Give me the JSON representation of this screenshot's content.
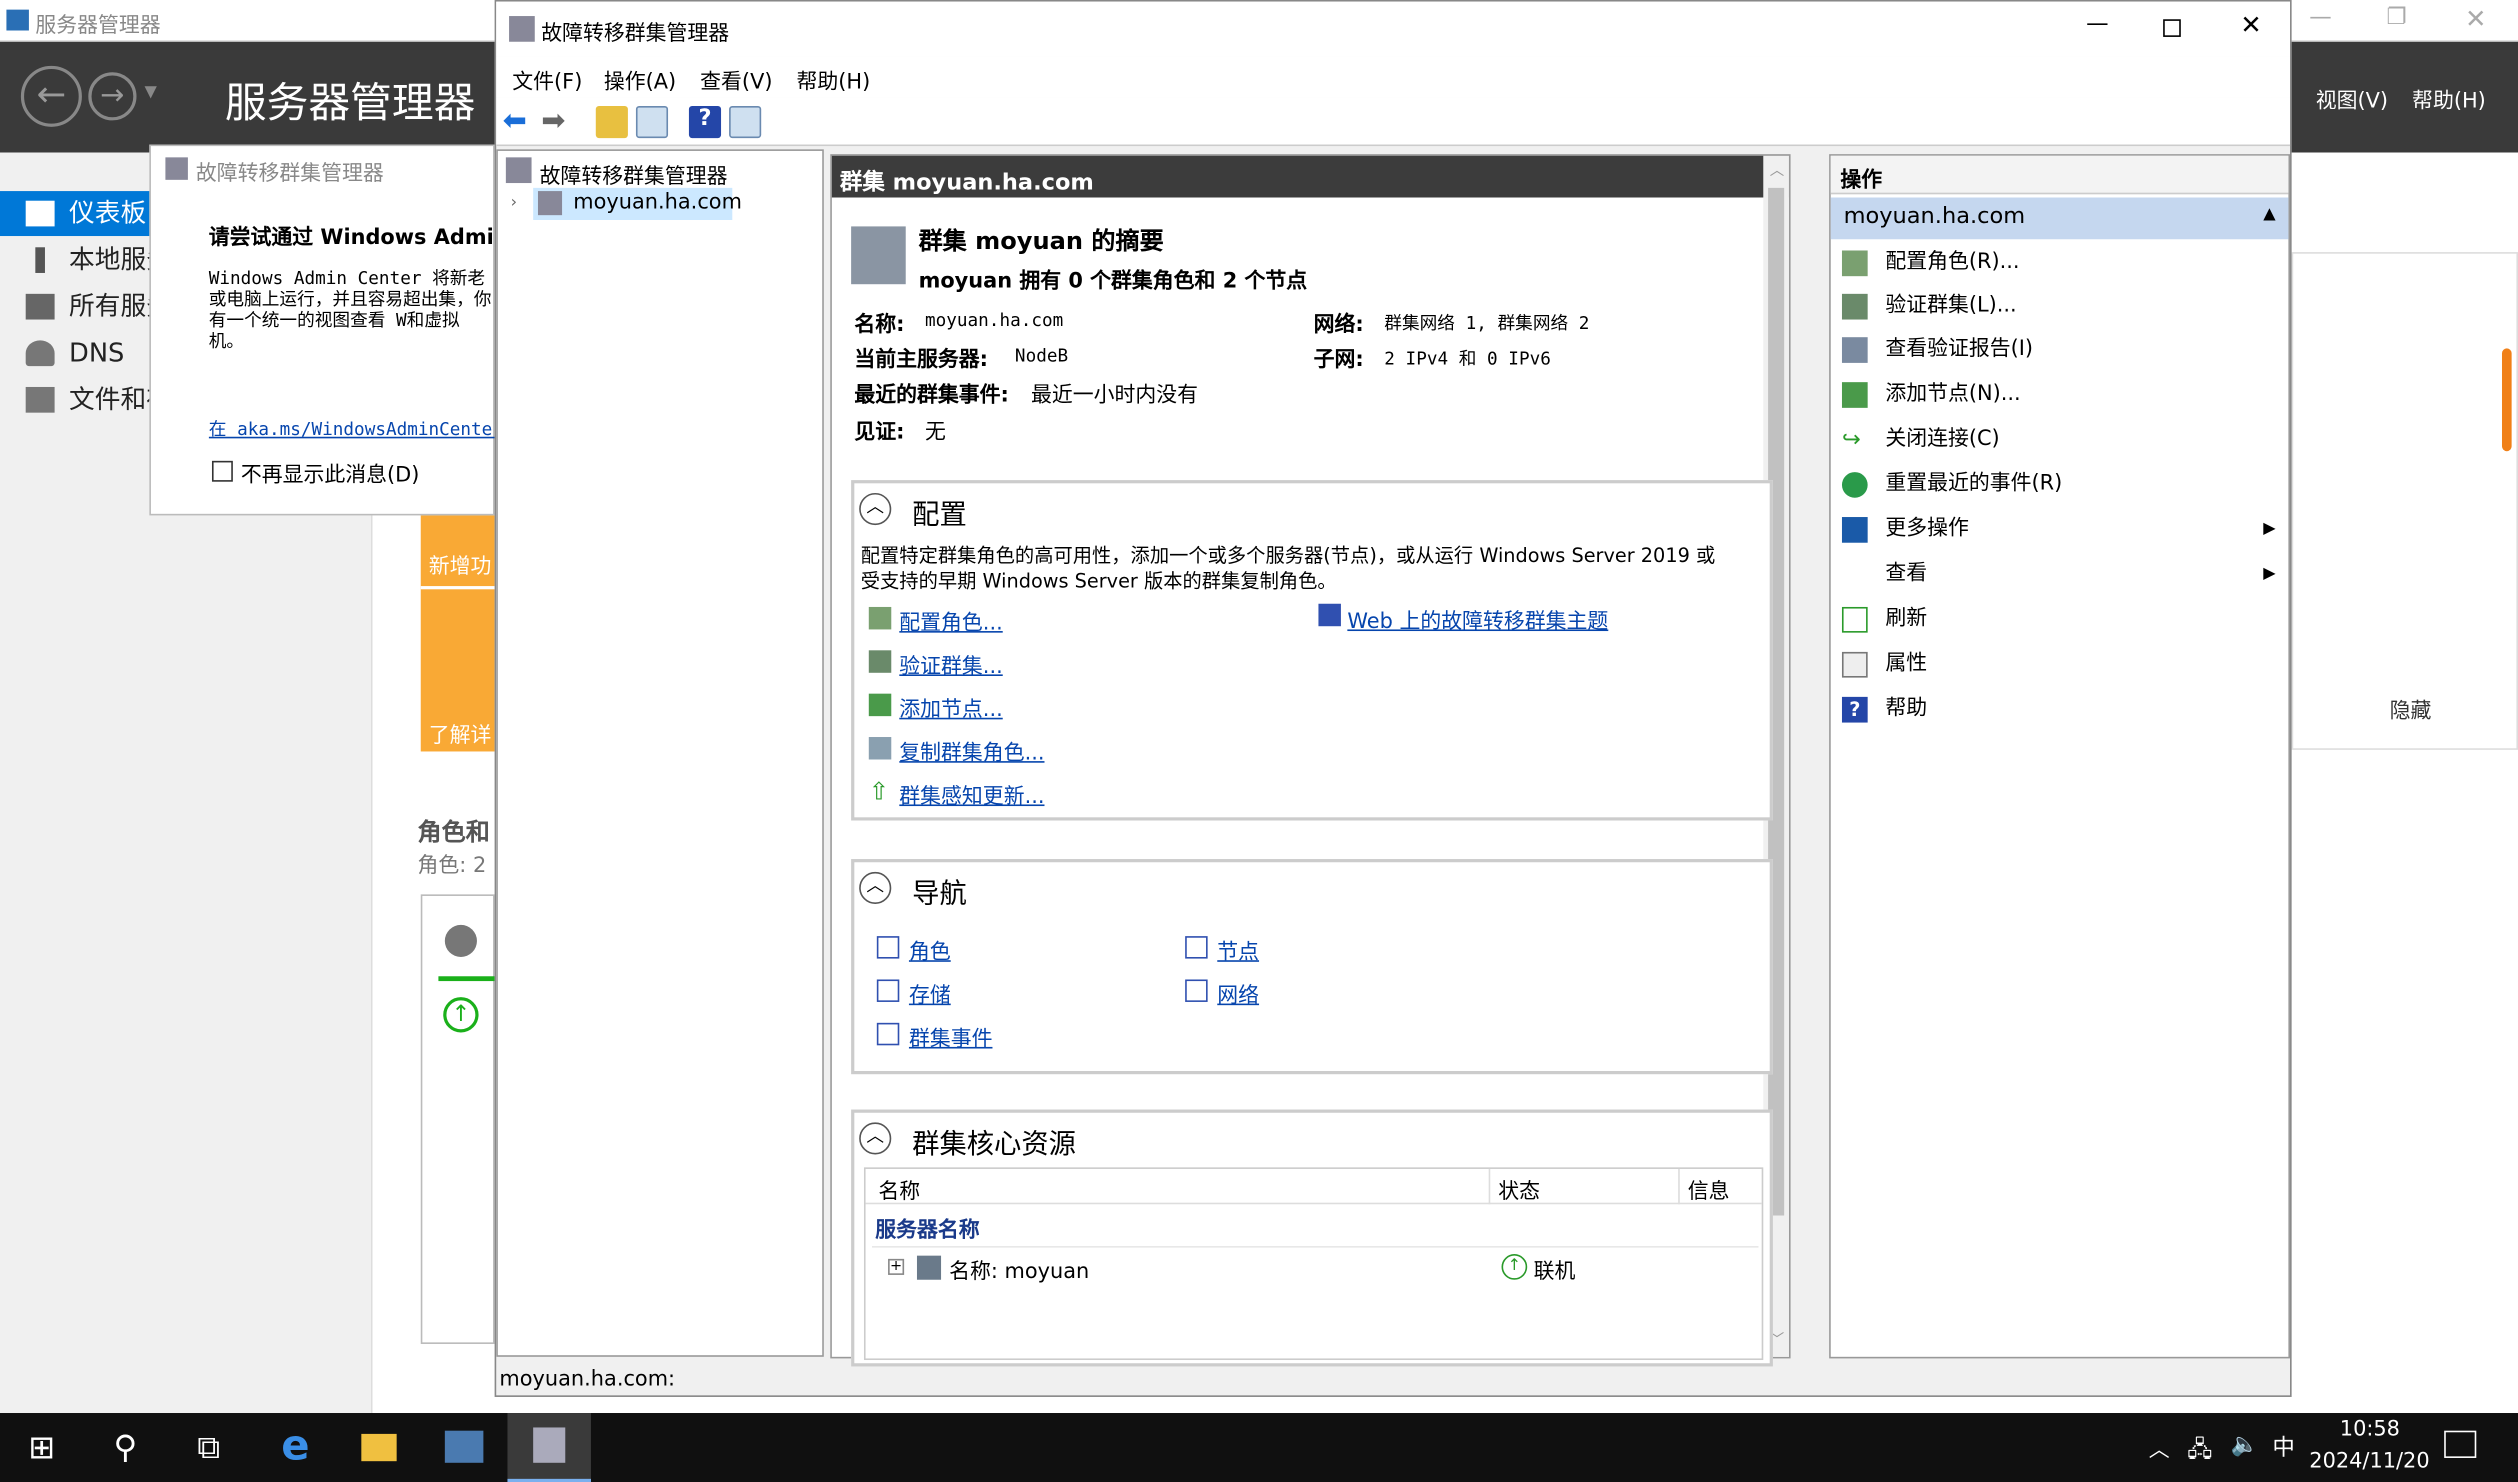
{
  "server_manager": {
    "window_title": "服务器管理器",
    "header_title": "服务器管理器",
    "menu_view": "视图(V)",
    "menu_help": "帮助(H)",
    "nav": [
      "仪表板",
      "本地服务",
      "所有服务",
      "DNS",
      "文件和存"
    ],
    "tile_new": "新增功",
    "tile_learn": "了解详",
    "roles_heading": "角色和",
    "roles_count": "角色: 2",
    "hide": "隐藏"
  },
  "wac_popup": {
    "title": "故障转移群集管理器",
    "heading": "请尝试通过 Windows Admin C",
    "body": "Windows Admin Center 将新老或电脑上运行，并且容易超出集，你有一个统一的视图查看 W和虚拟机。",
    "link": "在 aka.ms/WindowsAdminCenter",
    "checkbox": "不再显示此消息(D)"
  },
  "fcm": {
    "window_title": "故障转移群集管理器",
    "menu": [
      "文件(F)",
      "操作(A)",
      "查看(V)",
      "帮助(H)"
    ],
    "tree_root": "故障转移群集管理器",
    "tree_child": "moyuan.ha.com",
    "center_header": "群集 moyuan.ha.com",
    "summary_title": "群集 moyuan 的摘要",
    "summary_sub": "moyuan 拥有 0 个群集角色和 2 个节点",
    "name_label": "名称:",
    "name_value": "moyuan.ha.com",
    "host_label": "当前主服务器:",
    "host_value": "NodeB",
    "events_label": "最近的群集事件:",
    "events_value": "最近一小时内没有",
    "witness_label": "见证:",
    "witness_value": "无",
    "network_label": "网络:",
    "network_value": "群集网络 1, 群集网络 2",
    "subnet_label": "子网:",
    "subnet_value": "2 IPv4 和 0 IPv6",
    "config": {
      "title": "配置",
      "desc1": "配置特定群集角色的高可用性，添加一个或多个服务器(节点)，或从运行 Windows Server 2019 或",
      "desc2": "受支持的早期 Windows Server 版本的群集复制角色。",
      "links": [
        "配置角色...",
        "验证群集...",
        "添加节点...",
        "复制群集角色...",
        "群集感知更新..."
      ],
      "web_link": "Web 上的故障转移群集主题"
    },
    "nav": {
      "title": "导航",
      "links": [
        "角色",
        "节点",
        "存储",
        "网络",
        "群集事件"
      ]
    },
    "core": {
      "title": "群集核心资源",
      "columns": [
        "名称",
        "状态",
        "信息"
      ],
      "group": "服务器名称",
      "row_name": "名称: moyuan",
      "row_status": "联机"
    },
    "actions": {
      "header": "操作",
      "selected": "moyuan.ha.com",
      "items": [
        "配置角色(R)...",
        "验证群集(L)...",
        "查看验证报告(I)",
        "添加节点(N)...",
        "关闭连接(C)",
        "重置最近的事件(R)",
        "更多操作",
        "查看",
        "刷新",
        "属性",
        "帮助"
      ]
    },
    "status": "moyuan.ha.com:"
  },
  "taskbar": {
    "time": "10:58",
    "date": "2024/11/20",
    "ime": "中"
  },
  "colors": {
    "accent": "#0078d7",
    "header_dark": "#3a3a3a",
    "tile": "#f9a935",
    "link": "#0645ad"
  }
}
